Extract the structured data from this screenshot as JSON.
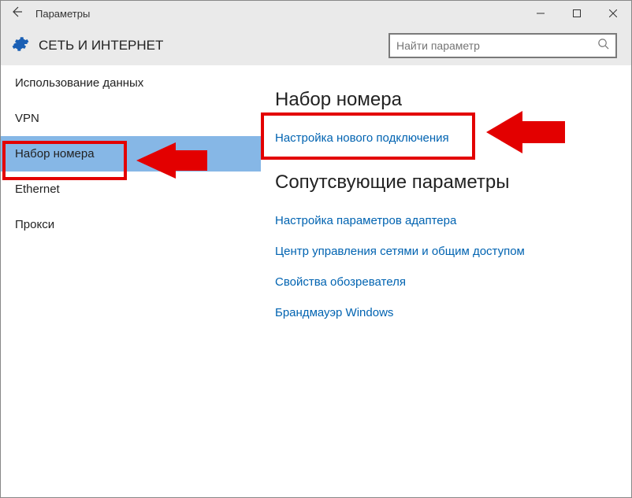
{
  "window": {
    "title": "Параметры"
  },
  "header": {
    "page_title": "СЕТЬ И ИНТЕРНЕТ",
    "search_placeholder": "Найти параметр"
  },
  "sidebar": {
    "items": [
      {
        "label": "Использование данных",
        "selected": false
      },
      {
        "label": "VPN",
        "selected": false
      },
      {
        "label": "Набор номера",
        "selected": true
      },
      {
        "label": "Ethernet",
        "selected": false
      },
      {
        "label": "Прокси",
        "selected": false
      }
    ]
  },
  "main": {
    "section1_title": "Набор номера",
    "new_connection_link": "Настройка нового подключения",
    "section2_title": "Сопутсвующие параметры",
    "links": [
      "Настройка параметров адаптера",
      "Центр управления сетями и общим доступом",
      "Свойства обозревателя",
      "Брандмауэр Windows"
    ]
  },
  "annotations": {
    "highlight_color": "#e30000"
  }
}
